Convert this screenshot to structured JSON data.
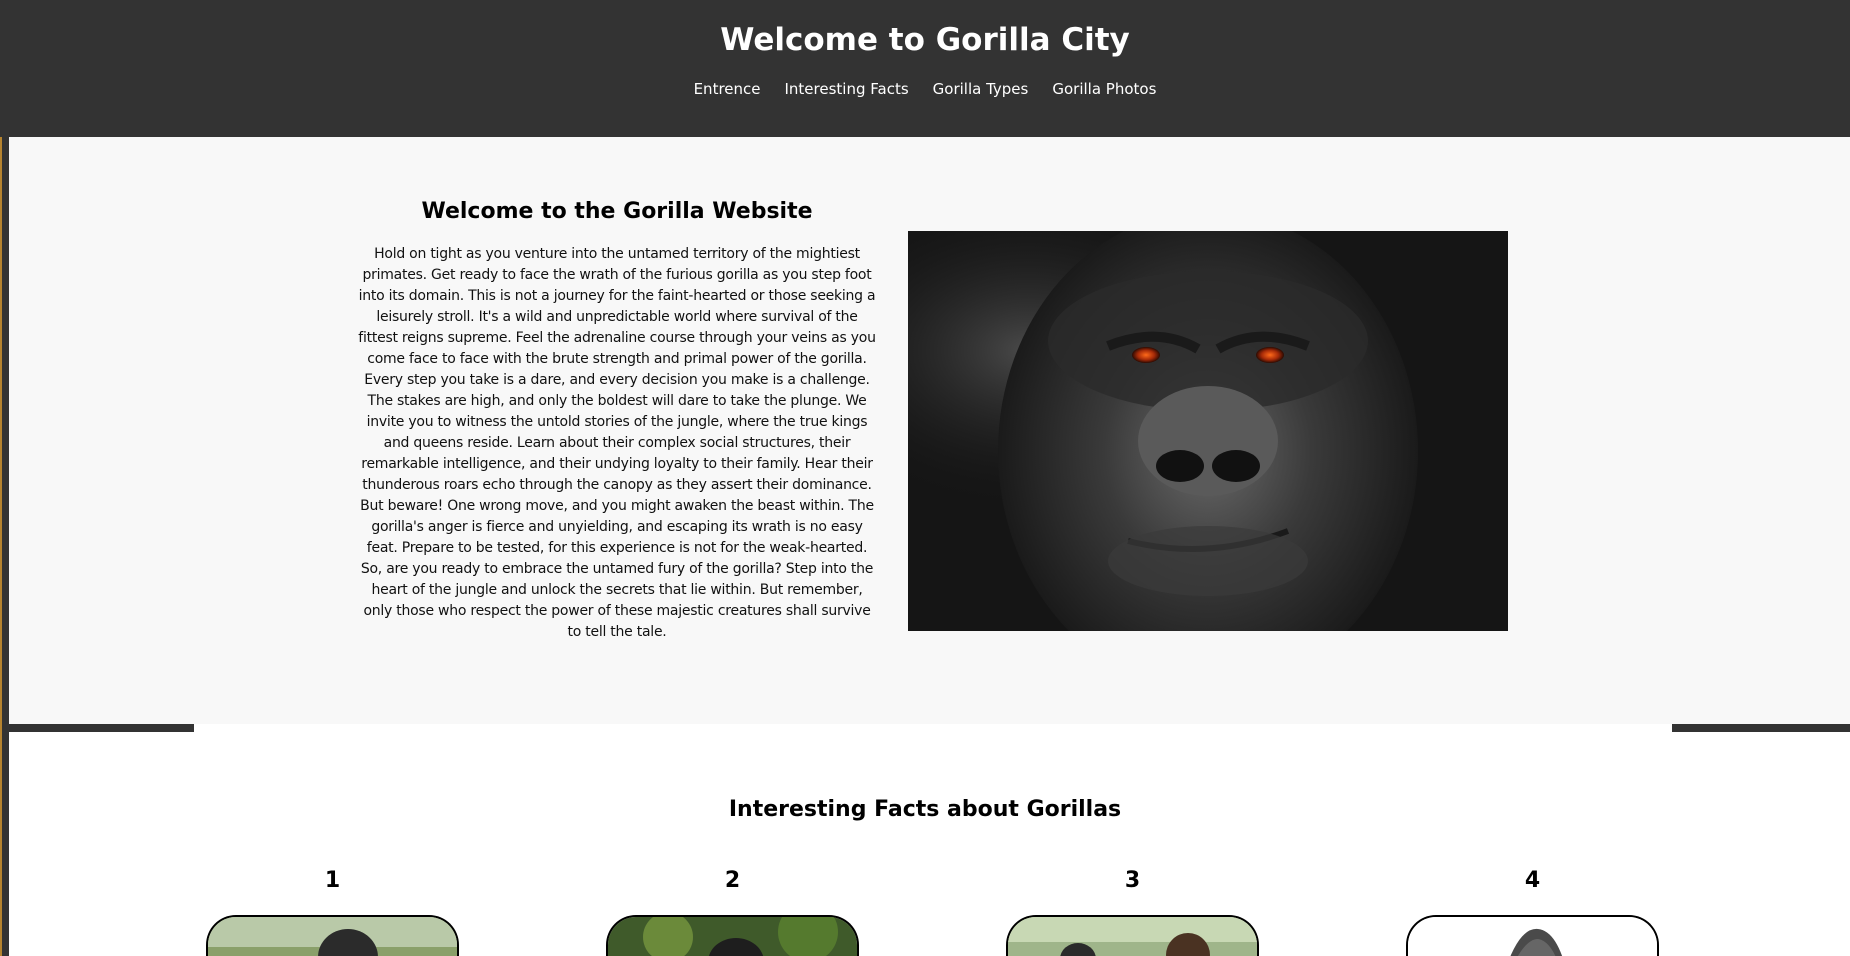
{
  "header": {
    "title": "Welcome to Gorilla City",
    "nav": [
      "Entrence",
      "Interesting Facts",
      "Gorilla Types",
      "Gorilla Photos"
    ]
  },
  "intro": {
    "heading": "Welcome to the Gorilla Website",
    "paragraph": "Hold on tight as you venture into the untamed territory of the mightiest primates. Get ready to face the wrath of the furious gorilla as you step foot into its domain. This is not a journey for the faint-hearted or those seeking a leisurely stroll. It's a wild and unpredictable world where survival of the fittest reigns supreme. Feel the adrenaline course through your veins as you come face to face with the brute strength and primal power of the gorilla. Every step you take is a dare, and every decision you make is a challenge. The stakes are high, and only the boldest will dare to take the plunge. We invite you to witness the untold stories of the jungle, where the true kings and queens reside. Learn about their complex social structures, their remarkable intelligence, and their undying loyalty to their family. Hear their thunderous roars echo through the canopy as they assert their dominance. But beware! One wrong move, and you might awaken the beast within. The gorilla's anger is fierce and unyielding, and escaping its wrath is no easy feat. Prepare to be tested, for this experience is not for the weak-hearted. So, are you ready to embrace the untamed fury of the gorilla? Step into the heart of the jungle and unlock the secrets that lie within. But remember, only those who respect the power of these majestic creatures shall survive to tell the tale."
  },
  "facts": {
    "heading": "Interesting Facts about Gorillas",
    "cards": [
      {
        "number": "1"
      },
      {
        "number": "2"
      },
      {
        "number": "3"
      },
      {
        "number": "4"
      }
    ]
  },
  "colors": {
    "header_bg": "#333333",
    "intro_bg": "#f8f8f8",
    "facts_bg": "#ffffff",
    "accent_border": "#b5832f"
  }
}
